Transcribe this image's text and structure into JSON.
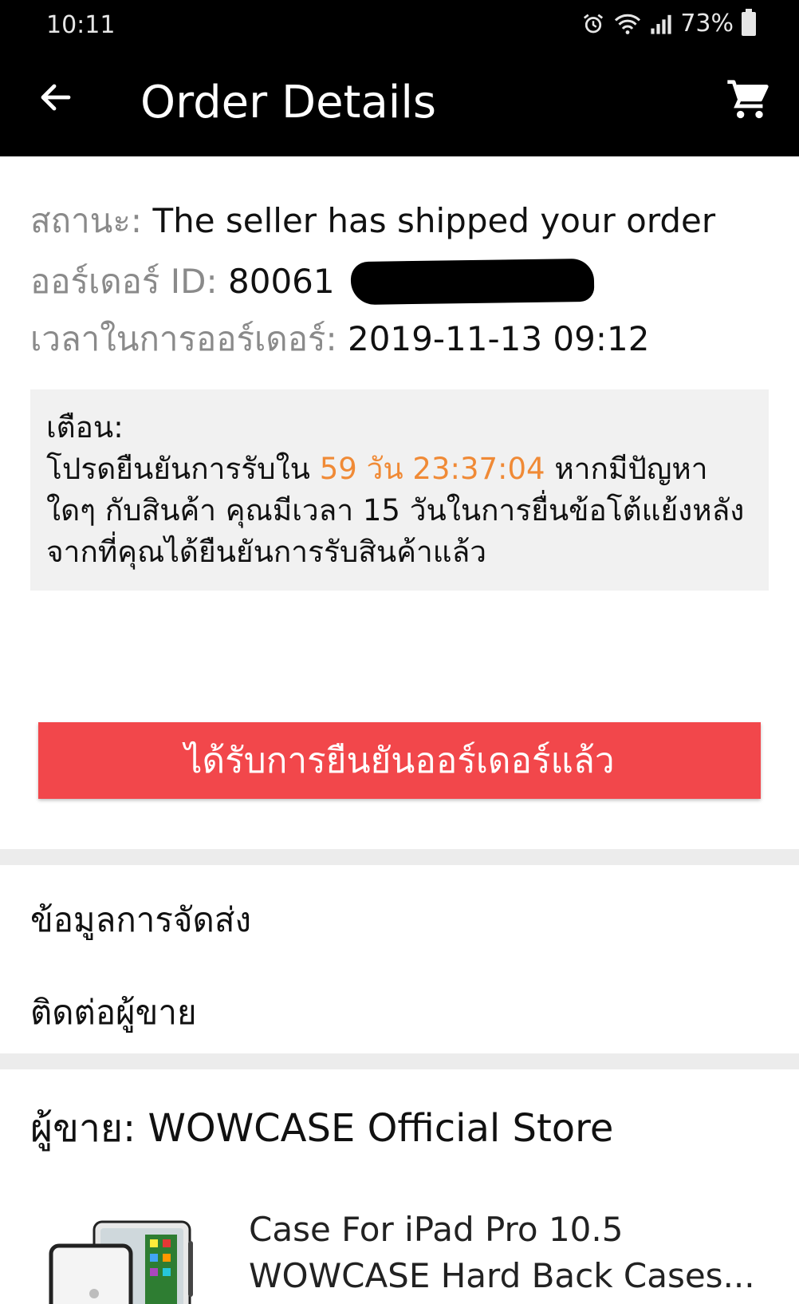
{
  "status_bar": {
    "time": "10:11",
    "battery": "73%"
  },
  "app_bar": {
    "title": "Order Details"
  },
  "order": {
    "status_label": "สถานะ:",
    "status_value": "The seller has shipped your order",
    "id_label": "ออร์เดอร์ ID:",
    "id_value": "80061",
    "time_label": "เวลาในการออร์เดอร์:",
    "time_value": "2019-11-13 09:12"
  },
  "notice": {
    "heading": "เตือน:",
    "text_before": "โปรดยืนยันการรับใน",
    "countdown": "59 วัน 23:37:04",
    "text_after": "หากมีปัญหาใดๆ กับสินค้า คุณมีเวลา 15 วันในการยื่นข้อโต้แย้งหลังจากที่คุณได้ยืนยันการรับสินค้าแล้ว",
    "highlight_color": "#f08a36"
  },
  "confirm_button": {
    "label": "ได้รับการยืนยันออร์เดอร์แล้ว",
    "color": "#f2474b"
  },
  "links": {
    "shipping_info": "ข้อมูลการจัดส่ง",
    "contact_seller": "ติดต่อผู้ขาย"
  },
  "seller": {
    "label": "ผู้ขาย:",
    "name": "WOWCASE Official Store"
  },
  "product": {
    "title": "Case For iPad Pro 10.5 WOWCASE Hard Back Cases..."
  },
  "icons": {
    "back": "arrow-left-icon",
    "cart": "cart-icon",
    "alarm": "alarm-icon",
    "wifi": "wifi-icon",
    "signal": "signal-icon",
    "battery": "battery-icon"
  }
}
